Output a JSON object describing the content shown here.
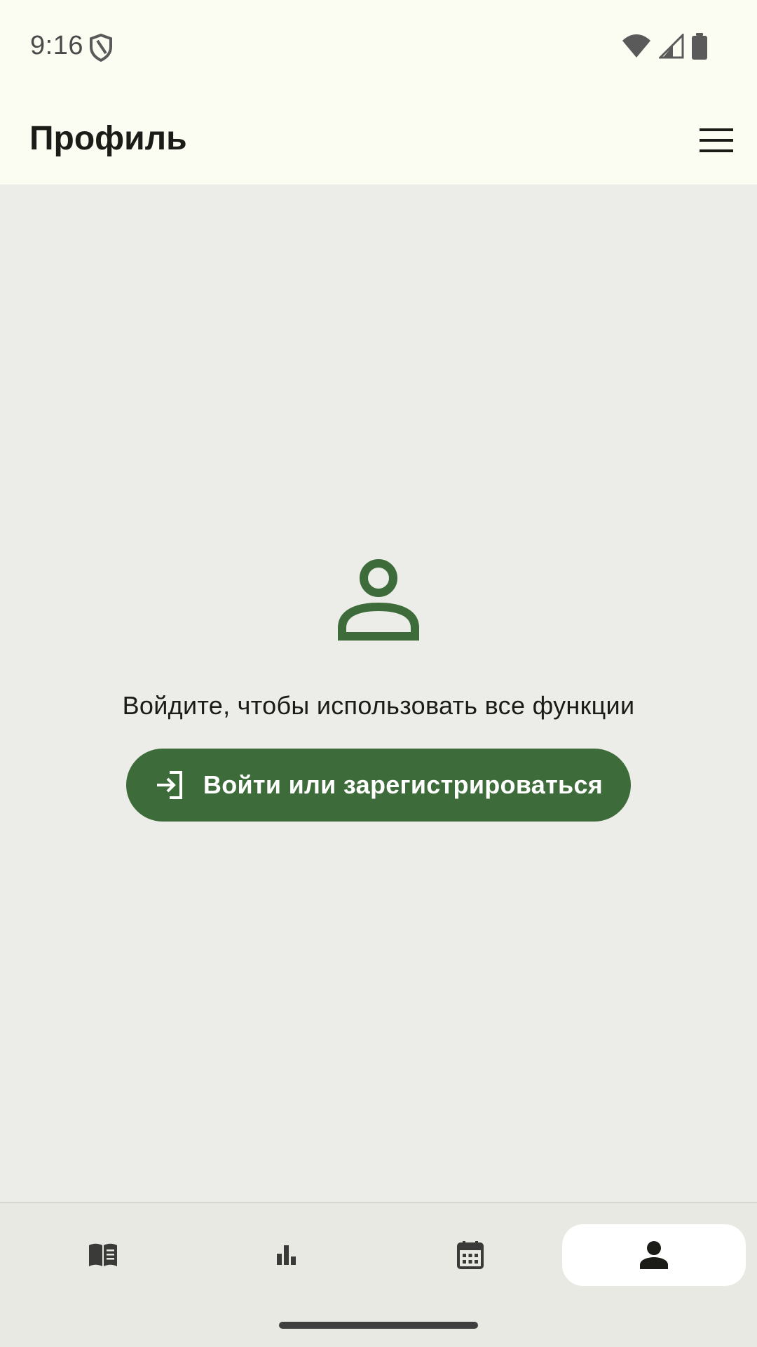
{
  "status_bar": {
    "time": "9:16",
    "icons": [
      "shield-icon",
      "wifi-icon",
      "cell-signal-icon",
      "battery-icon"
    ]
  },
  "app_bar": {
    "title": "Профиль",
    "menu_icon": "hamburger-menu-icon"
  },
  "empty_state": {
    "icon": "person-outline-icon",
    "message": "Войдите, чтобы использовать все функции",
    "button_label": "Войти или зарегистрироваться",
    "button_icon": "login-icon"
  },
  "bottom_nav": {
    "items": [
      {
        "icon": "book-icon",
        "active": false
      },
      {
        "icon": "bar-chart-icon",
        "active": false
      },
      {
        "icon": "calendar-icon",
        "active": false
      },
      {
        "icon": "person-icon",
        "active": true
      }
    ]
  },
  "colors": {
    "accent": "#3e6b3a",
    "top_background": "#fbfdf2",
    "content_background": "#ecece8",
    "nav_background": "#e8e9e3",
    "active_pill": "#ffffff",
    "text_primary": "#1b1c18"
  }
}
